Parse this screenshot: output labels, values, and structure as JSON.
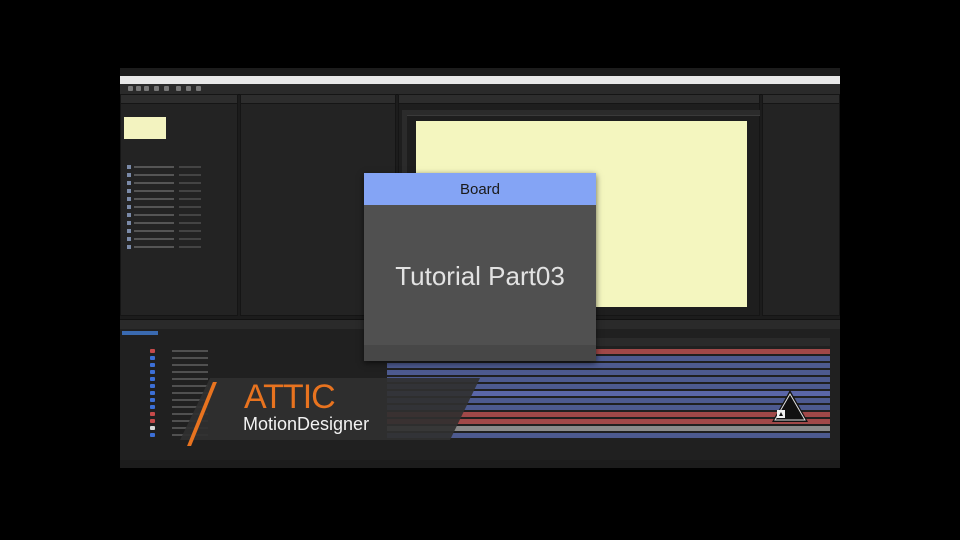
{
  "overlay": {
    "card_title": "Board",
    "card_subtitle": "Tutorial Part03"
  },
  "brand": {
    "title": "ATTIC",
    "subtitle": "MotionDesigner",
    "accent_color": "#e8731f"
  },
  "colors": {
    "canvas": "#f4f6bf",
    "card_header": "#84a4f5",
    "card_body": "#505050",
    "background": "#000000"
  },
  "icons": [
    "triangle-logo-icon"
  ]
}
